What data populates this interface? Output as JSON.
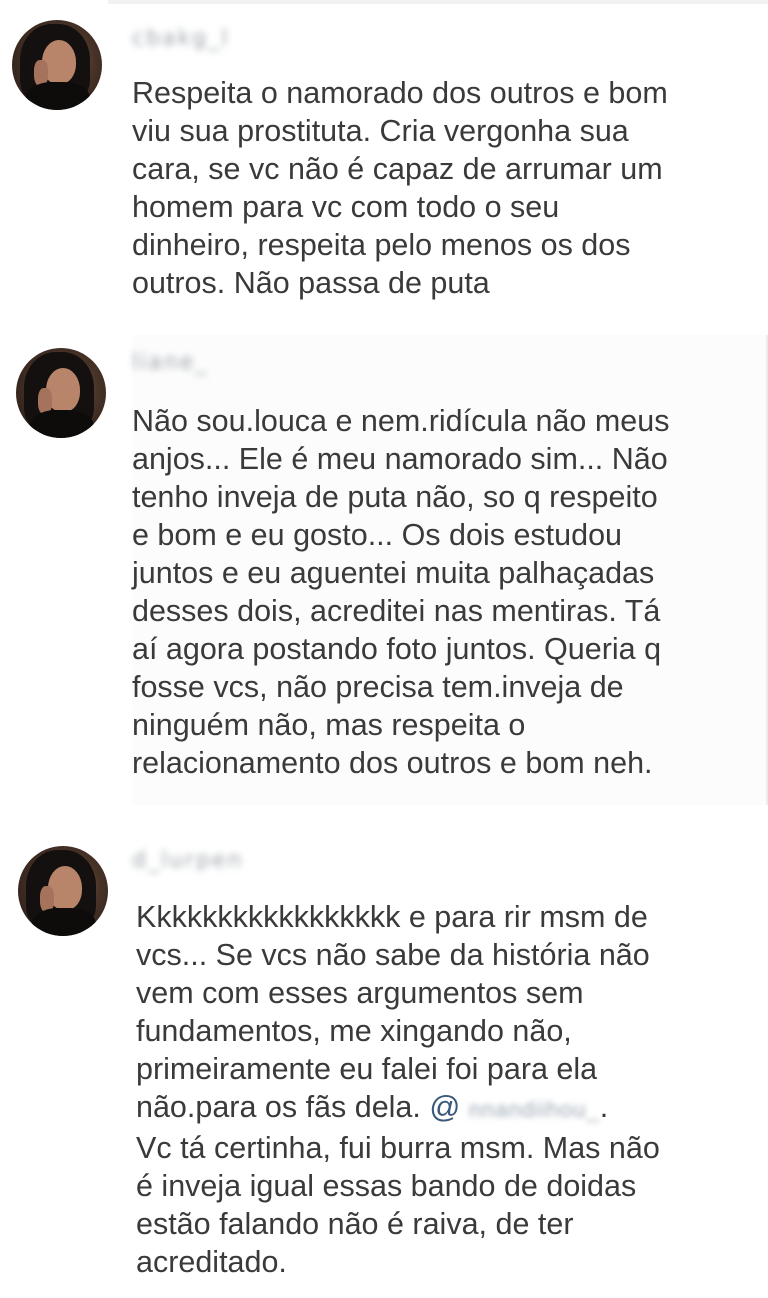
{
  "comments": [
    {
      "username": "cbakg_l",
      "text": "Respeita o namorado dos outros e bom\nviu sua prostituta. Cria vergonha sua\ncara, se vc não é capaz de arrumar um\nhomem para vc com todo o seu\ndinheiro, respeita pelo menos os dos\noutros. Não passa de puta"
    },
    {
      "username": "liane_",
      "text": "Não sou.louca e nem.ridícula não meus\nanjos... Ele é meu namorado sim... Não\ntenho inveja de puta não, so q respeito\ne bom e eu gosto... Os dois estudou\njuntos e eu aguentei muita palhaçadas\ndesses dois, acreditei nas mentiras. Tá\naí agora postando foto juntos. Queria q\nfosse vcs, não precisa tem.inveja de\nninguém não, mas respeita o\nrelacionamento dos outros e bom neh."
    },
    {
      "username": "d_lurpen",
      "text_before_mention": "Kkkkkkkkkkkkkkkkk e para rir msm de\nvcs... Se vcs não sabe da história não\nvem com esses argumentos sem\nfundamentos, me xingando não,\nprimeiramente eu falei foi para ela\nnão.para os fãs dela. ",
      "mention_at": "@",
      "mention_name": "nnandiihou_",
      "text_after_mention": ".\nVc tá certinha, fui burra msm. Mas não\né inveja igual essas bando de doidas\nestão falando não é raiva, de ter\nacreditado."
    }
  ]
}
